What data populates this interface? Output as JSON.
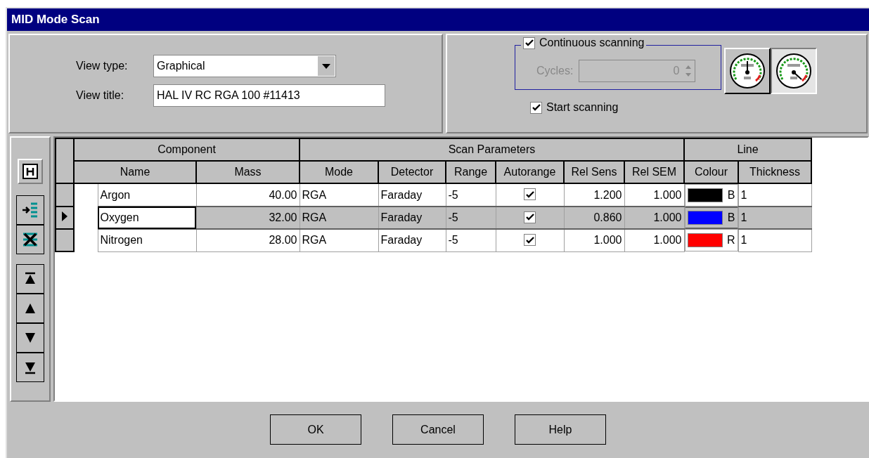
{
  "window": {
    "title": "MID Mode Scan"
  },
  "view": {
    "type_label": "View type:",
    "type_value": "Graphical",
    "title_label": "View title:",
    "title_value": "HAL IV RC RGA 100 #11413"
  },
  "scanning": {
    "continuous": {
      "label": "Continuous scanning",
      "checked": true
    },
    "cycles": {
      "label": "Cycles:",
      "value": "0",
      "disabled": true
    },
    "start": {
      "label": "Start scanning",
      "checked": true
    },
    "gauges": [
      {
        "selected": false,
        "kind": "vertical"
      },
      {
        "selected": true,
        "kind": "tilted"
      }
    ]
  },
  "toolbar": [
    {
      "kind": "info"
    },
    {
      "kind": "insert"
    },
    {
      "kind": "delete"
    },
    {
      "kind": "top"
    },
    {
      "kind": "up"
    },
    {
      "kind": "down"
    },
    {
      "kind": "bottom"
    }
  ],
  "table": {
    "groups": [
      {
        "label": "Component"
      },
      {
        "label": "Scan Parameters"
      },
      {
        "label": "Line"
      }
    ],
    "columns": [
      "Name",
      "Mass",
      "Mode",
      "Detector",
      "Range",
      "Autorange",
      "Rel Sens",
      "Rel SEM",
      "Colour",
      "Thickness"
    ],
    "rows": [
      {
        "selected": false,
        "name": "Argon",
        "mass": "40.00",
        "mode": "RGA",
        "detector": "Faraday",
        "range": "-5",
        "autorange": true,
        "rel_sens": "1.200",
        "rel_sem": "1.000",
        "color": "#000000",
        "colour_code": "B",
        "thickness": "1"
      },
      {
        "selected": true,
        "name": "Oxygen",
        "mass": "32.00",
        "mode": "RGA",
        "detector": "Faraday",
        "range": "-5",
        "autorange": true,
        "rel_sens": "0.860",
        "rel_sem": "1.000",
        "color": "#0000ff",
        "colour_code": "B",
        "thickness": "1"
      },
      {
        "selected": false,
        "name": "Nitrogen",
        "mass": "28.00",
        "mode": "RGA",
        "detector": "Faraday",
        "range": "-5",
        "autorange": true,
        "rel_sens": "1.000",
        "rel_sem": "1.000",
        "color": "#ff0000",
        "colour_code": "R",
        "thickness": "1"
      }
    ]
  },
  "buttons": [
    "OK",
    "Cancel",
    "Help"
  ]
}
